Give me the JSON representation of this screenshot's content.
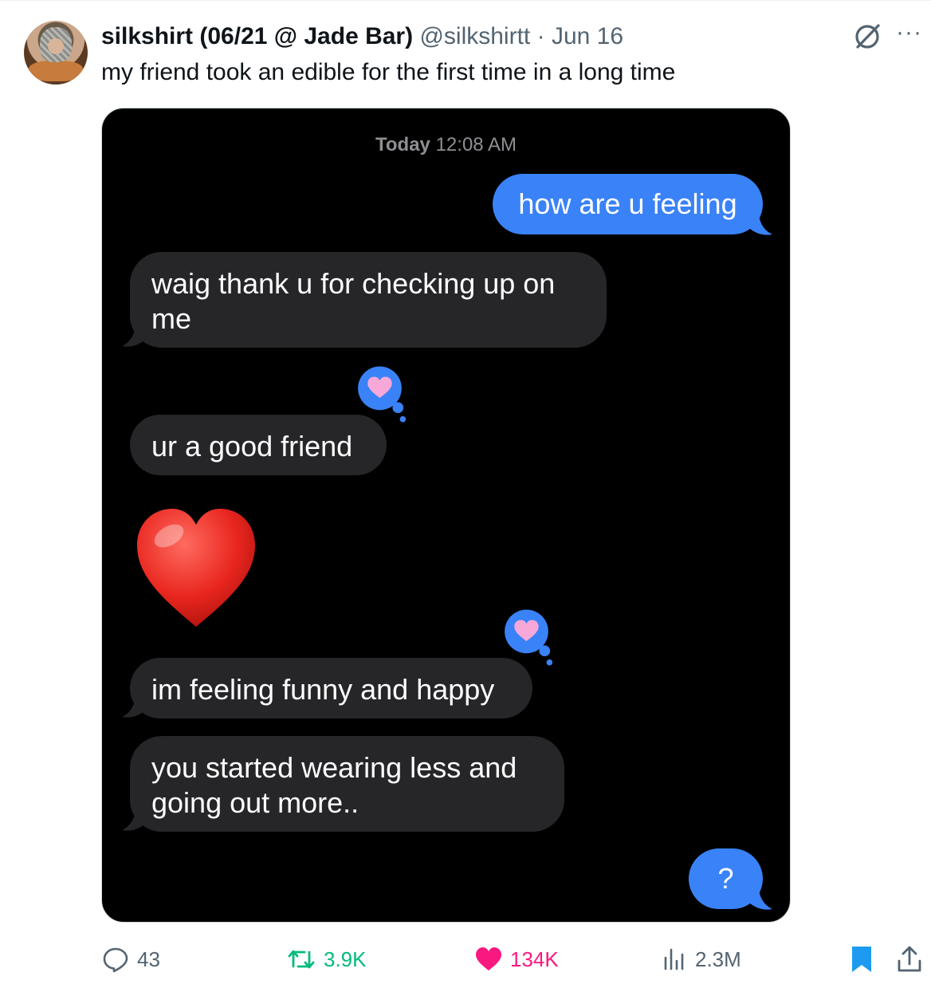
{
  "tweet": {
    "author_name": "silkshirt (06/21 @ Jade Bar)",
    "handle": "@silkshirtt",
    "separator": "·",
    "date": "Jun 16",
    "text": "my friend took an edible for the first time in a long time",
    "more_label": "···"
  },
  "screenshot": {
    "timestamp_day": "Today",
    "timestamp_time": "12:08 AM",
    "messages": [
      {
        "side": "sent",
        "text": "how are u feeling"
      },
      {
        "side": "received",
        "text": "waig thank u for checking up on me"
      },
      {
        "side": "received",
        "text": "ur a good friend",
        "tapback": "heart"
      },
      {
        "side": "received",
        "text": "❤️",
        "emoji_only": true
      },
      {
        "side": "received",
        "text": "im feeling funny and happy",
        "tapback": "heart"
      },
      {
        "side": "received",
        "text": "you started wearing less and going out more.."
      },
      {
        "side": "sent",
        "text": "?"
      }
    ],
    "colors": {
      "sent": "#3a82f7",
      "received": "#262629",
      "background": "#000000"
    }
  },
  "actions": {
    "replies": "43",
    "reposts": "3.9K",
    "likes": "134K",
    "views": "2.3M",
    "colors": {
      "repost": "#00ba7c",
      "like": "#f91880",
      "bookmark": "#1d9bf0",
      "muted": "#536471"
    }
  }
}
